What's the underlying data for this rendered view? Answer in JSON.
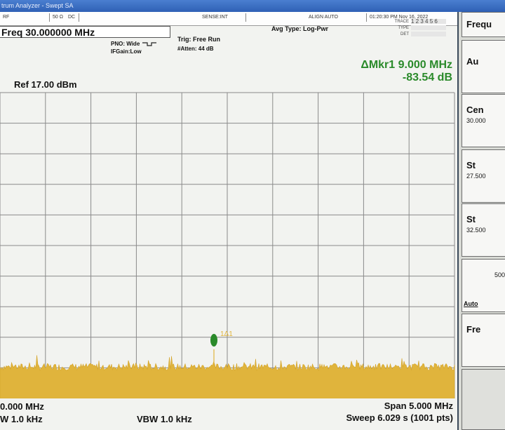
{
  "window": {
    "title": "trum Analyzer - Swept SA"
  },
  "status_bar": {
    "rf": "RF",
    "ohm": "50 Ω",
    "coupling": "DC",
    "sense": "SENSE:INT",
    "align": "ALIGN AUTO",
    "datetime": "01:20:30 PM Nov 16, 2022"
  },
  "header": {
    "freq": "Freq 30.000000 MHz",
    "pno": "PNO: Wide",
    "ifgain": "IFGain:Low",
    "trig": "Trig: Free Run",
    "atten": "#Atten: 44 dB",
    "avg_type": "Avg Type: Log-Pwr",
    "trace_label": "TRACE",
    "type_label": "TYPE",
    "det_label": "DET",
    "trace_value": "1 2 3 4 5 6"
  },
  "marker": {
    "delta_freq": "ΔMkr1 9.000 MHz",
    "delta_level": "-83.54 dB",
    "label": "1Δ1",
    "color": "#2a8a2a"
  },
  "display": {
    "ref_level": "Ref 17.00 dBm",
    "trace_color": "#e0b43c",
    "center_partial": "0.000 MHz",
    "rbw_partial": "W 1.0 kHz",
    "vbw": "VBW 1.0 kHz",
    "span": "Span 5.000 MHz",
    "sweep": "Sweep  6.029 s (1001 pts)"
  },
  "softkeys": {
    "items": [
      {
        "label": "Frequ"
      },
      {
        "label": "Au"
      },
      {
        "label": "Cen",
        "value": "30.000"
      },
      {
        "label": "St",
        "value": "27.500"
      },
      {
        "label": "St",
        "value": "32.500"
      },
      {
        "label": "",
        "value": "500",
        "mode": "Auto"
      },
      {
        "label": "Fre"
      }
    ]
  }
}
